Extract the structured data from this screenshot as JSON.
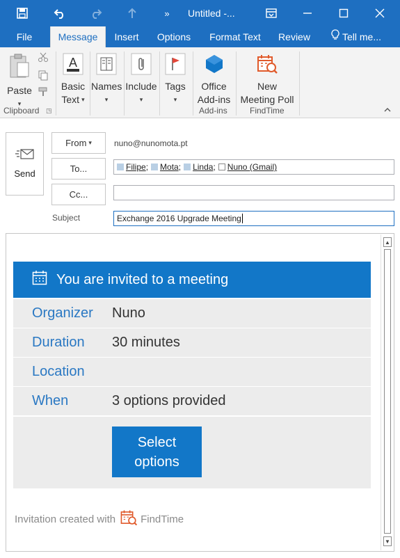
{
  "titlebar": {
    "title": "Untitled -...",
    "save_icon": "save-icon",
    "undo_icon": "undo-icon",
    "redo_icon": "redo-icon",
    "up_icon": "up-arrow-icon",
    "more_icon": "more-commands-icon"
  },
  "tabs": [
    {
      "label": "File"
    },
    {
      "label": "Message",
      "active": true
    },
    {
      "label": "Insert"
    },
    {
      "label": "Options"
    },
    {
      "label": "Format Text"
    },
    {
      "label": "Review"
    },
    {
      "label": "Tell me..."
    }
  ],
  "ribbon": {
    "paste": "Paste",
    "basic_text": [
      "Basic",
      "Text"
    ],
    "names": "Names",
    "include": "Include",
    "tags": "Tags",
    "office_addins": [
      "Office",
      "Add-ins"
    ],
    "new_meeting_poll": [
      "New",
      "Meeting Poll"
    ],
    "groups": {
      "clipboard": "Clipboard",
      "addins": "Add-ins",
      "findtime": "FindTime"
    }
  },
  "compose": {
    "send": "Send",
    "from_label": "From",
    "from_value": "nuno@nunomota.pt",
    "to_label": "To...",
    "cc_label": "Cc...",
    "subject_label": "Subject",
    "subject_value": "Exchange 2016 Upgrade Meeting",
    "recipients": [
      {
        "name": "Filipe",
        "sep": ";"
      },
      {
        "name": "Mota",
        "sep": ";"
      },
      {
        "name": "Linda",
        "sep": ";"
      },
      {
        "name": "Nuno (Gmail)",
        "sep": ""
      }
    ],
    "cc_value": ""
  },
  "invite": {
    "heading": "You are invited to a meeting",
    "rows": [
      {
        "key": "Organizer",
        "value": "Nuno"
      },
      {
        "key": "Duration",
        "value": "30 minutes"
      },
      {
        "key": "Location",
        "value": ""
      },
      {
        "key": "When",
        "value": "3 options provided"
      }
    ],
    "button": [
      "Select",
      "options"
    ],
    "footer_text": "Invitation created with",
    "footer_brand": "FindTime"
  },
  "colors": {
    "accent": "#1277c8",
    "titlebar": "#1e6fc1",
    "key_text": "#2a78c3",
    "row_bg": "#ececec",
    "findtime_red": "#e05a2b"
  }
}
